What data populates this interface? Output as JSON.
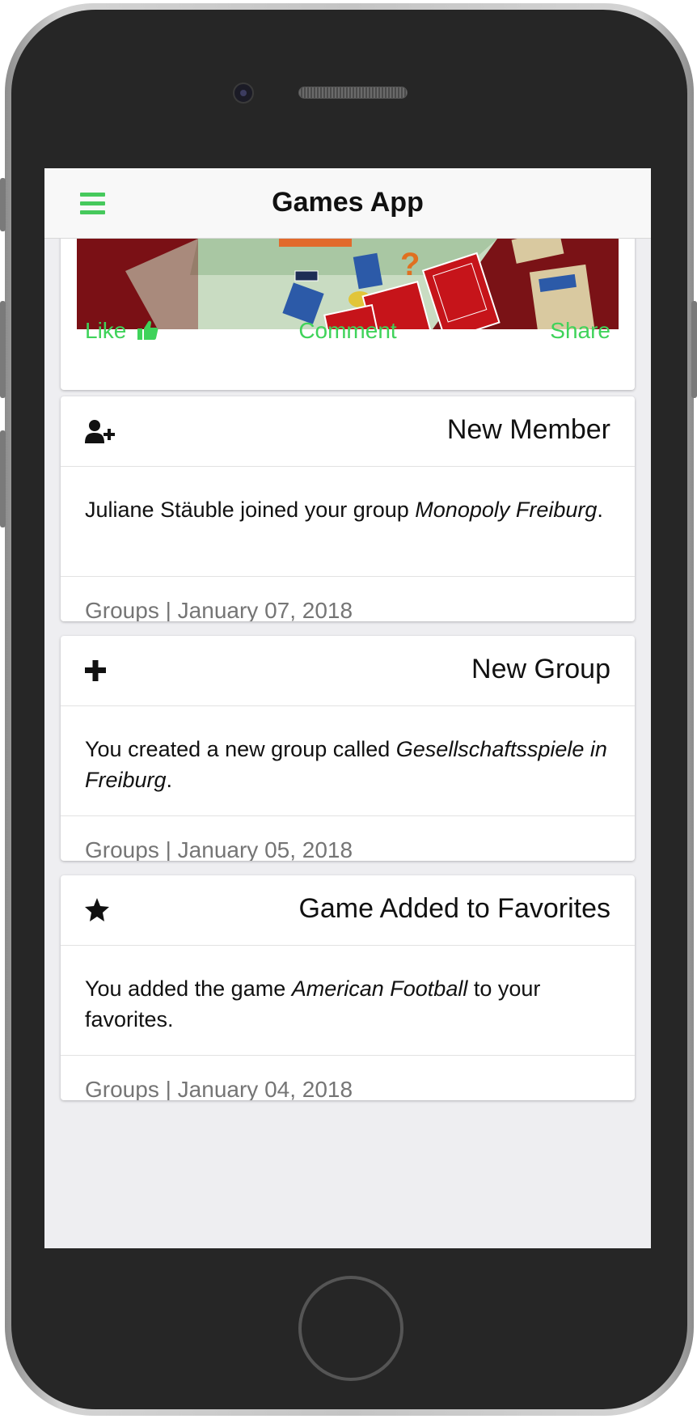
{
  "app": {
    "title": "Games App"
  },
  "post": {
    "actions": {
      "like": "Like",
      "comment": "Comment",
      "share": "Share"
    }
  },
  "notifications": [
    {
      "icon": "user-plus-icon",
      "title": "New Member",
      "body_pre": "Juliane Stäuble joined your group ",
      "body_em": "Monopoly Freiburg",
      "body_post": ".",
      "category": "Groups",
      "separator": "|",
      "date": "January 07, 2018"
    },
    {
      "icon": "plus-icon",
      "title": "New Group",
      "body_pre": "You created a new group called ",
      "body_em": "Gesellschaftsspiele in Freiburg",
      "body_post": ".",
      "category": "Groups",
      "separator": "|",
      "date": "January 05, 2018"
    },
    {
      "icon": "star-icon",
      "title": "Game Added to Favorites",
      "body_pre": "You added the game ",
      "body_em": "American Football",
      "body_post": " to your favorites.",
      "category": "Groups",
      "separator": "|",
      "date": "January 04, 2018"
    }
  ],
  "colors": {
    "accent": "#3fd35a",
    "text": "#111111",
    "muted": "#757575",
    "background": "#eeeef1"
  }
}
